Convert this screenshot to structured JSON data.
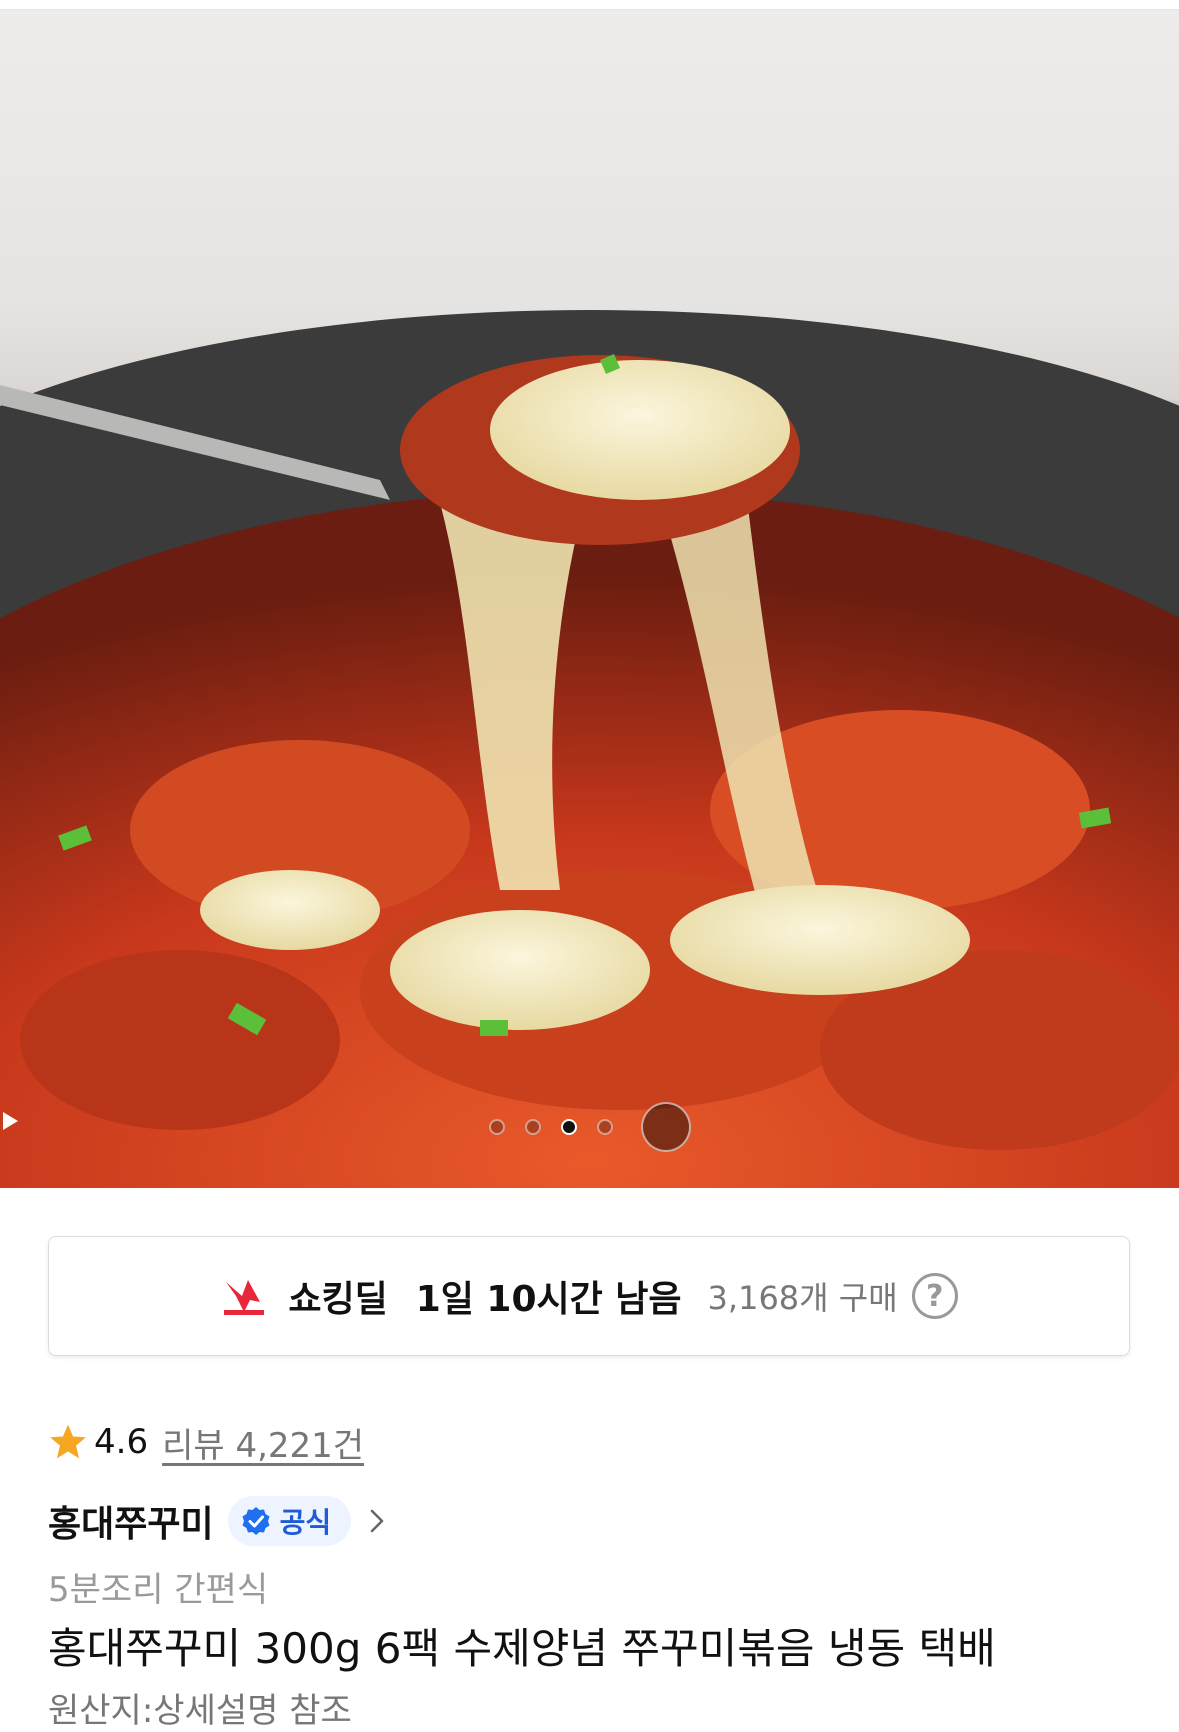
{
  "deal": {
    "label": "쇼킹딜",
    "time_left": "1일 10시간 남음",
    "purchase_count": "3,168개 구매",
    "help_glyph": "?"
  },
  "carousel": {
    "total_dots": 4,
    "active_index": 2,
    "video_control": "play-icon"
  },
  "rating": {
    "value": "4.6",
    "reviews": "리뷰 4,221건"
  },
  "seller": {
    "name": "홍대쭈꾸미",
    "badge": "공식"
  },
  "product": {
    "subtitle": "5분조리 간편식",
    "title": "홍대쭈꾸미 300g 6팩 수제양념 쭈꾸미볶음 냉동 택배",
    "origin": "원산지:상세설명 참조"
  },
  "colors": {
    "deal_icon": "#e8283a",
    "star": "#f5a623",
    "official_badge_text": "#1f5bd6",
    "official_badge_bg": "#eef4ff"
  }
}
